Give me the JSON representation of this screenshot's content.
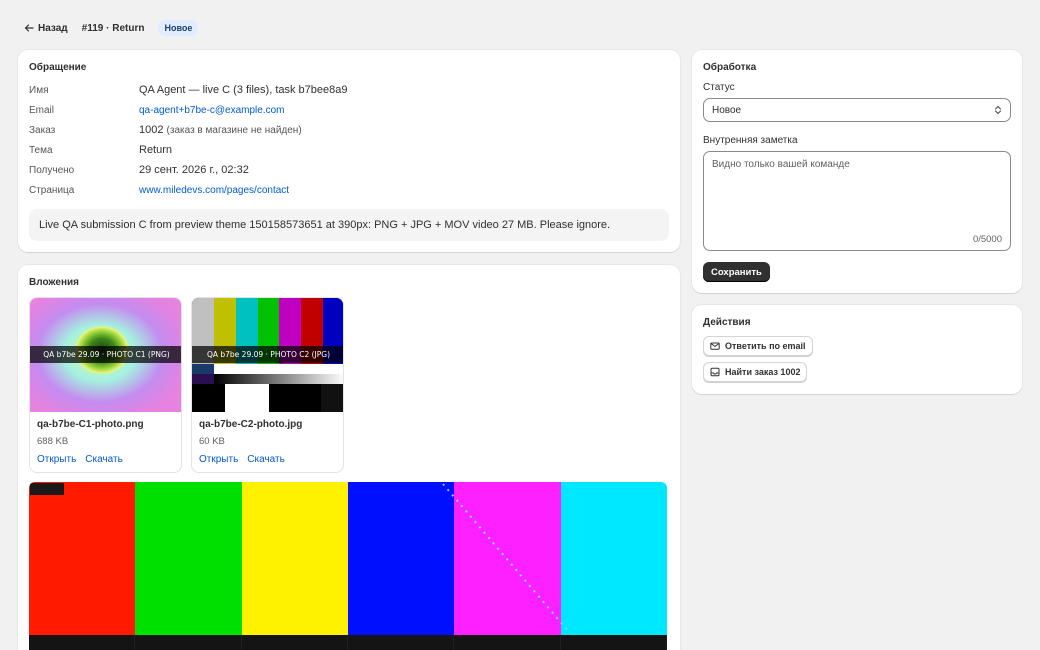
{
  "header": {
    "back_label": "Назад",
    "ticket_title": "#119 · Return",
    "status_badge": "Новое"
  },
  "request": {
    "title": "Обращение",
    "fields": [
      {
        "key": "Имя",
        "value": "QA Agent — live C (3 files), task b7bee8a9"
      },
      {
        "key": "Email",
        "value": "qa-agent+b7be-c@example.com"
      },
      {
        "key": "Заказ",
        "value": "1002",
        "note": "(заказ в магазине не найден)"
      },
      {
        "key": "Тема",
        "value": "Return"
      },
      {
        "key": "Получено",
        "value": "29 сент. 2026 г., 02:32"
      },
      {
        "key": "Страница",
        "value": "www.miledevs.com/pages/contact"
      }
    ],
    "message": "Live QA submission C from preview theme 150158573651 at 390px: PNG + JPG + MOV video 27 MB. Please ignore."
  },
  "attachments": {
    "title": "Вложения",
    "items": [
      {
        "caption": "QA b7be 29.09 · PHOTO C1 (PNG)",
        "name": "qa-b7be-C1-photo.png",
        "size": "688 KB",
        "open_label": "Открыть",
        "download_label": "Скачать"
      },
      {
        "caption": "QA b7be 29.09 · PHOTO C2 (JPG)",
        "name": "qa-b7be-C2-photo.jpg",
        "size": "60 KB",
        "open_label": "Открыть",
        "download_label": "Скачать"
      }
    ],
    "video_bar_colors": [
      "#ff1a00",
      "#00e000",
      "#fff200",
      "#0010ff",
      "#ff20ff",
      "#00e8ff"
    ]
  },
  "processing": {
    "title": "Обработка",
    "status_label": "Статус",
    "status_value": "Новое",
    "note_label": "Внутренняя заметка",
    "note_placeholder": "Видно только вашей команде",
    "note_counter": "0/5000",
    "save_label": "Сохранить"
  },
  "actions": {
    "title": "Действия",
    "reply_label": "Ответить по email",
    "find_order_label": "Найти заказ 1002"
  },
  "colors": {
    "link": "#005bd3",
    "badge_bg": "#e0ecff",
    "primary_button": "#303030",
    "page_bg": "#f1f1f1"
  }
}
